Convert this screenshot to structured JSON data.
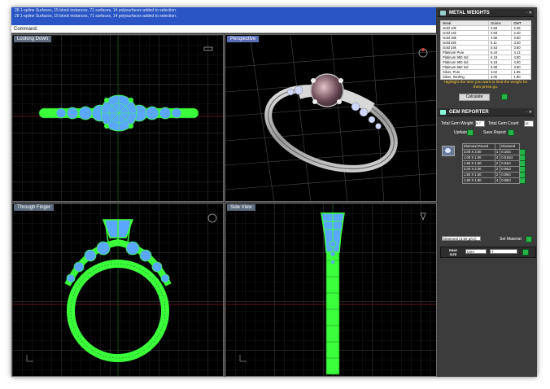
{
  "command_history": {
    "line1": "28 1-spline Surfaces, 15 block instances, 71 surfaces, 14 polysurfaces added to selection.",
    "line2": "28 1-spline Surfaces, 15 block instances, 71 surfaces, 14 polysurfaces added to selection."
  },
  "command_prompt": "Command:",
  "viewports": {
    "top": "Looking Down",
    "perspective": "Perspective",
    "front": "Through Finger",
    "right": "Side View"
  },
  "metal_weights": {
    "title": "METAL WEIGHTS",
    "columns": [
      "Metal",
      "Grams",
      "DWT"
    ],
    "rows": [
      [
        "Gold 10k",
        "3.58",
        "2.45"
      ],
      [
        "Gold 14k",
        "3.93",
        "2.40"
      ],
      [
        "Gold 18k",
        "4.65",
        "3.00"
      ],
      [
        "Gold 22k",
        "5.11",
        "3.30"
      ],
      [
        "Gold 24k",
        "5.53",
        "3.60"
      ],
      [
        "Platinum Pure",
        "6.44",
        "4.12"
      ],
      [
        "Platinum 950 Ind",
        "6.18",
        "4.00"
      ],
      [
        "Platinum 900 Ind",
        "6.18",
        "4.00"
      ],
      [
        "Platinum 850 Ind",
        "5.99",
        "3.80"
      ],
      [
        "Silver, Pure",
        "3.02",
        "1.95"
      ],
      [
        "Silver, Sterling",
        "3.00",
        "1.90"
      ]
    ],
    "hint": "Highlight the item you want to limit the weight for then press go.",
    "calculate": "Calculate"
  },
  "gem_reporter": {
    "title": "GEM REPORTER",
    "total_weight_label": "Total Gem Weight",
    "total_weight_value": "0.?",
    "total_count_label": "Total Gem Count",
    "total_count_value": "15",
    "update": "Update",
    "save_report": "Save Report",
    "columns": [
      "Diamond Round",
      "",
      "Diamond"
    ],
    "rows": [
      [
        "3.00 X 3.00",
        "1",
        "0.10ct"
      ],
      [
        "1.00 X 1.00",
        "4",
        "0.016ct"
      ],
      [
        "1.50 X 1.50",
        "2",
        "0.03ct"
      ],
      [
        "2.00 X 2.00",
        "2",
        "0.06ct"
      ],
      [
        "1.50 X 1.50",
        "2",
        "0.09ct"
      ],
      [
        "1.80 X 1.80",
        "4",
        "0.09ct"
      ]
    ],
    "stone_select": "Diamond (3.52 g/cc)",
    "set_material": "Set Material"
  },
  "ring_size": {
    "label_top": "RING",
    "label_bottom": "SIZE",
    "system": "USA",
    "size": "7"
  }
}
